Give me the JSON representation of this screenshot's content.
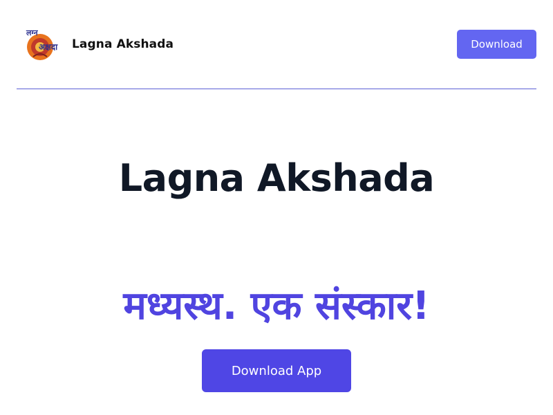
{
  "header": {
    "brand_name": "Lagna Akshada",
    "logo_text_line1": "लग्न",
    "logo_text_line2": "अक्षदा",
    "download_label": "Download"
  },
  "hero": {
    "title": "Lagna Akshada",
    "tagline": "मध्यस्थ. एक संस्कार!",
    "cta_label": "Download App"
  },
  "colors": {
    "accent": "#6366f1",
    "cta": "#4f46e5",
    "tagline": "#5044e0",
    "title": "#101826",
    "divider": "#5b5fd6"
  }
}
